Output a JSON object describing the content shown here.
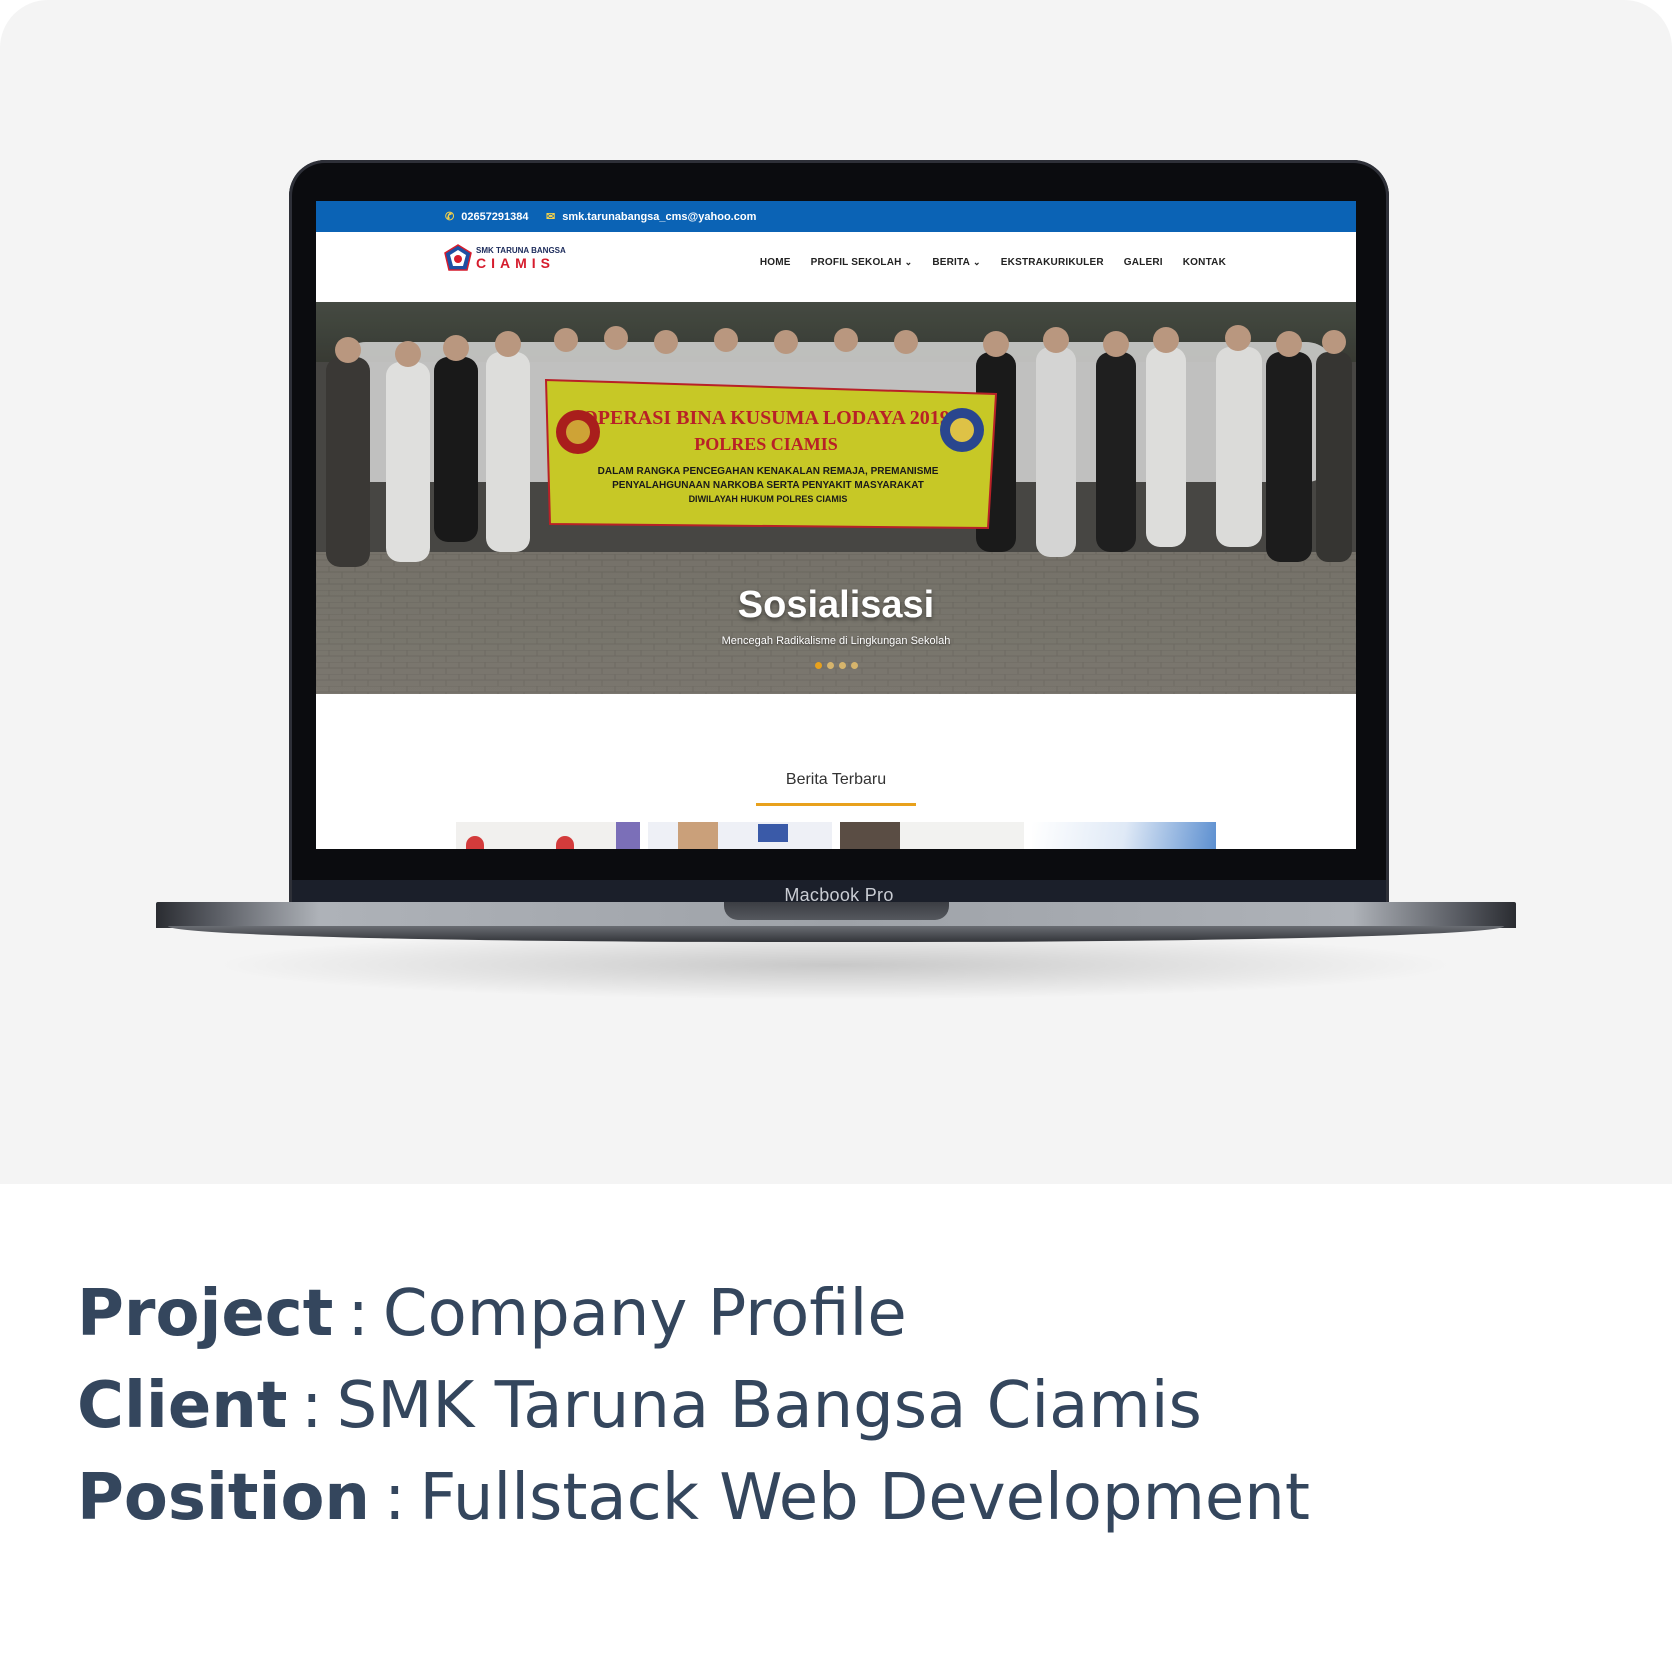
{
  "device": {
    "label": "Macbook Pro"
  },
  "website": {
    "topbar": {
      "phone": "02657291384",
      "email": "smk.tarunabangsa_cms@yahoo.com"
    },
    "logo": {
      "line1": "SMK TARUNA BANGSA",
      "line2": "CIAMIS"
    },
    "nav": [
      {
        "label": "HOME",
        "has_dropdown": false
      },
      {
        "label": "PROFIL SEKOLAH",
        "has_dropdown": true
      },
      {
        "label": "BERITA",
        "has_dropdown": true
      },
      {
        "label": "EKSTRAKURIKULER",
        "has_dropdown": false
      },
      {
        "label": "GALERI",
        "has_dropdown": false
      },
      {
        "label": "KONTAK",
        "has_dropdown": false
      }
    ],
    "hero": {
      "banner_line1": "OPERASI BINA KUSUMA LODAYA 2019",
      "banner_line2": "POLRES CIAMIS",
      "banner_line3": "DALAM RANGKA PENCEGAHAN KENAKALAN REMAJA, PREMANISME",
      "banner_line4": "PENYALAHGUNAAN NARKOBA SERTA PENYAKIT MASYARAKAT",
      "banner_line5": "DIWILAYAH HUKUM POLRES CIAMIS",
      "title": "Sosialisasi",
      "subtitle": "Mencegah Radikalisme di Lingkungan Sekolah",
      "slide_count": 4,
      "active_slide": 1
    },
    "news": {
      "heading": "Berita Terbaru"
    },
    "colors": {
      "topbar": "#0b63b5",
      "accent": "#e8a11c",
      "logo_red": "#d61c2d"
    }
  },
  "caption": {
    "project": {
      "label": "Project",
      "value": "Company Profile"
    },
    "client": {
      "label": "Client",
      "value": "SMK Taruna Bangsa Ciamis"
    },
    "position": {
      "label": "Position",
      "value": "Fullstack Web Development"
    }
  }
}
